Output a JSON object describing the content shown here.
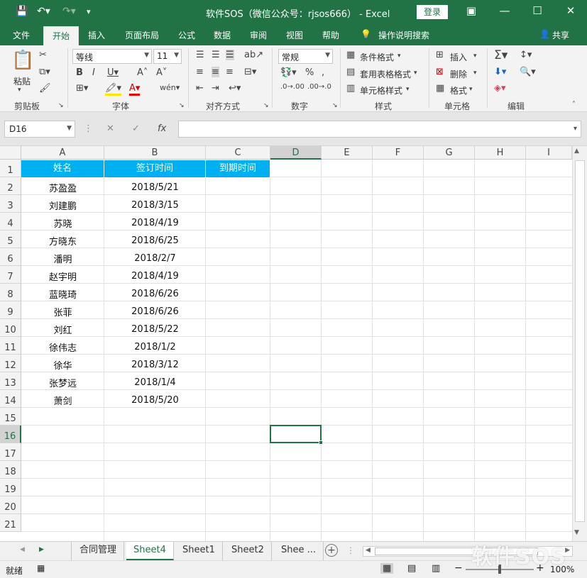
{
  "title_bar": {
    "window_title": "软件SOS（微信公众号：rjsos666） - Excel",
    "login_label": "登录",
    "save_icon": "save-icon",
    "undo_icon": "undo-icon",
    "redo_icon": "redo-icon"
  },
  "ribbon_tabs": [
    "文件",
    "开始",
    "插入",
    "页面布局",
    "公式",
    "数据",
    "审阅",
    "视图",
    "帮助"
  ],
  "active_tab": "开始",
  "tell_me": "操作说明搜索",
  "share_label": "共享",
  "ribbon": {
    "clipboard": {
      "group": "剪贴板",
      "paste": "粘贴"
    },
    "font": {
      "group": "字体",
      "font_name": "等线",
      "font_size": "11"
    },
    "alignment": {
      "group": "对齐方式"
    },
    "number": {
      "group": "数字",
      "format": "常规"
    },
    "styles": {
      "group": "样式",
      "conditional": "条件格式",
      "table": "套用表格格式",
      "cell": "单元格样式"
    },
    "cells": {
      "group": "单元格",
      "insert": "插入",
      "delete": "删除",
      "format": "格式"
    },
    "editing": {
      "group": "编辑"
    }
  },
  "formula_bar": {
    "name_box": "D16",
    "content": ""
  },
  "columns": [
    "A",
    "B",
    "C",
    "D",
    "E",
    "F",
    "G",
    "H",
    "I"
  ],
  "rows": [
    "1",
    "2",
    "3",
    "4",
    "5",
    "6",
    "7",
    "8",
    "9",
    "10",
    "11",
    "12",
    "13",
    "14",
    "15",
    "16",
    "17",
    "18",
    "19",
    "20",
    "21"
  ],
  "headers": [
    "姓名",
    "签订时间",
    "到期时间"
  ],
  "data_rows": [
    {
      "name": "苏盈盈",
      "date": "2018/5/21"
    },
    {
      "name": "刘建鹏",
      "date": "2018/3/15"
    },
    {
      "name": "苏晓",
      "date": "2018/4/19"
    },
    {
      "name": "方晓东",
      "date": "2018/6/25"
    },
    {
      "name": "潘明",
      "date": "2018/2/7"
    },
    {
      "name": "赵宇明",
      "date": "2018/4/19"
    },
    {
      "name": "蓝晓琦",
      "date": "2018/6/26"
    },
    {
      "name": "张菲",
      "date": "2018/6/26"
    },
    {
      "name": "刘红",
      "date": "2018/5/22"
    },
    {
      "name": "徐伟志",
      "date": "2018/1/2"
    },
    {
      "name": "徐华",
      "date": "2018/3/12"
    },
    {
      "name": "张梦远",
      "date": "2018/1/4"
    },
    {
      "name": "萧剑",
      "date": "2018/5/20"
    }
  ],
  "sheets": [
    "合同管理",
    "Sheet4",
    "Sheet1",
    "Sheet2",
    "Shee ..."
  ],
  "active_sheet": "Sheet4",
  "status": {
    "ready": "就绪",
    "zoom": "100%"
  },
  "watermark": "软件SOS",
  "colors": {
    "excel_green": "#217346",
    "header_fill": "#00b0f0"
  }
}
